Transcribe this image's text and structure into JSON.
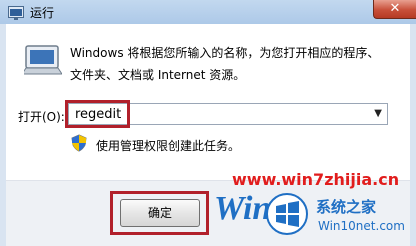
{
  "window": {
    "title": "运行",
    "close_label": "✕"
  },
  "dialog": {
    "description_line1": "Windows 将根据您所输入的名称，为您打开相应的程序、",
    "description_line2": "文件夹、文档或 Internet 资源。",
    "open_label": "打开(O):",
    "input_value": "regedit",
    "admin_note": "使用管理权限创建此任务。",
    "ok_label": "确定"
  },
  "watermark": {
    "url": "www.win7zhijia.cn",
    "brand_word": "Win",
    "site_cn": "系统之家",
    "site_en": "Win10net.com"
  },
  "colors": {
    "highlight": "#b1202b",
    "watermark_red": "#e11d1d",
    "watermark_blue": "#1f6fc4"
  },
  "icons": [
    "run-app-icon",
    "run-dialog-icon",
    "uac-shield-icon",
    "dropdown-arrow-icon",
    "windows-logo-icon"
  ]
}
